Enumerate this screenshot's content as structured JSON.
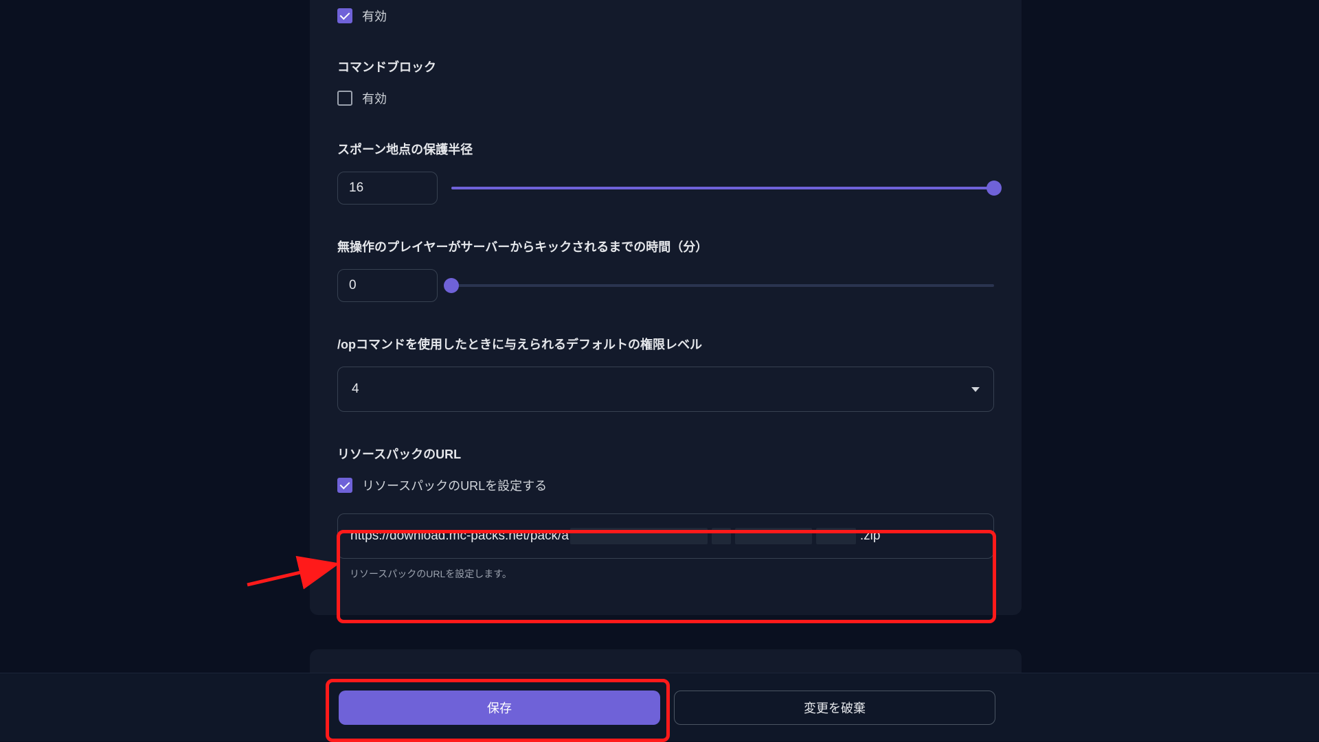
{
  "sections": {
    "first_checkbox_label": "有効",
    "command_block": {
      "title": "コマンドブロック",
      "enabled_label": "有効"
    },
    "spawn_protection": {
      "title": "スポーン地点の保護半径",
      "value": "16"
    },
    "idle_timeout": {
      "title": "無操作のプレイヤーがサーバーからキックされるまでの時間（分）",
      "value": "0"
    },
    "op_permission": {
      "title": "/opコマンドを使用したときに与えられるデフォルトの権限レベル",
      "value": "4"
    },
    "resource_pack": {
      "title": "リソースパックのURL",
      "checkbox_label": "リソースパックのURLを設定する",
      "url_prefix": "https://download.mc-packs.net/pack/a",
      "url_suffix": ".zip",
      "helper": "リソースパックのURLを設定します。"
    }
  },
  "buttons": {
    "save": "保存",
    "discard": "変更を破棄"
  }
}
